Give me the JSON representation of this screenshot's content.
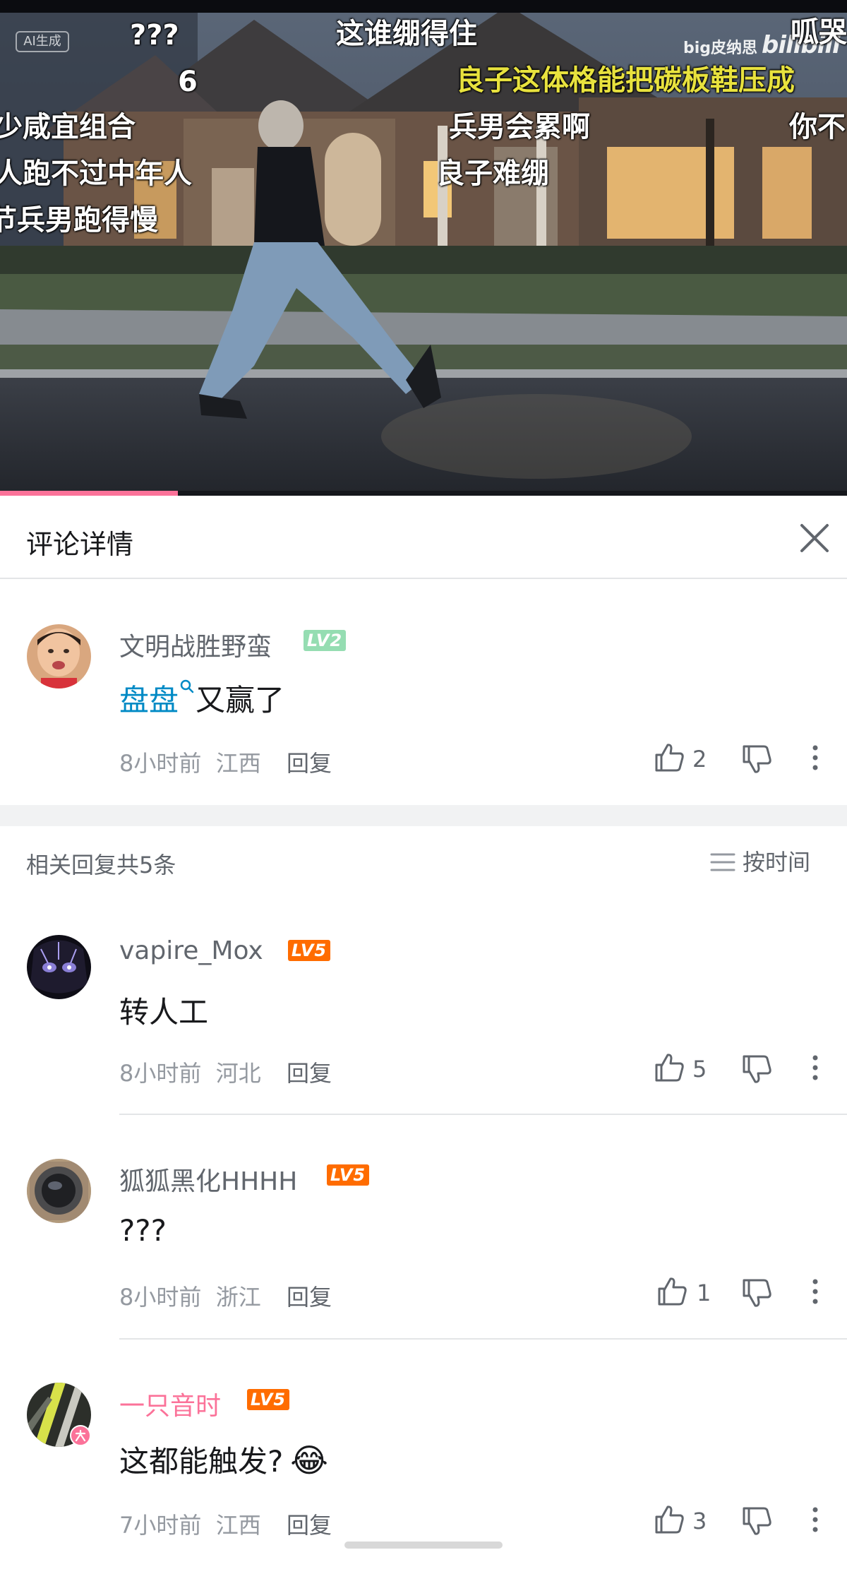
{
  "video": {
    "ai_badge": "AI生成",
    "watermark_name": "big皮纳思",
    "watermark_logo": "bilibili",
    "progress_fraction": 0.21,
    "danmaku": [
      {
        "text": "???",
        "color": "white"
      },
      {
        "text": "这谁绷得住",
        "color": "white"
      },
      {
        "text": "呱哭",
        "color": "white"
      },
      {
        "text": "6",
        "color": "white"
      },
      {
        "text": "良子这体格能把碳板鞋压成",
        "color": "yellow"
      },
      {
        "text": "少咸宜组合",
        "color": "white"
      },
      {
        "text": "兵男会累啊",
        "color": "white"
      },
      {
        "text": "你不",
        "color": "white"
      },
      {
        "text": "人跑不过中年人",
        "color": "white"
      },
      {
        "text": "良子难绷",
        "color": "white"
      },
      {
        "text": "节兵男跑得慢",
        "color": "white"
      }
    ]
  },
  "panel": {
    "title": "评论详情"
  },
  "root_comment": {
    "username": "文明战胜野蛮",
    "level": "LV2",
    "link_text": "盘盘",
    "text": "又赢了",
    "time": "8小时前",
    "location": "江西",
    "reply": "回复",
    "likes": "2"
  },
  "replies_header": {
    "count_text": "相关回复共5条",
    "sort_label": "按时间"
  },
  "replies": [
    {
      "username": "vapire_Mox",
      "level": "LV5",
      "text": "转人工",
      "time": "8小时前",
      "location": "河北",
      "reply": "回复",
      "likes": "5"
    },
    {
      "username": "狐狐黑化HHHH",
      "level": "LV5",
      "text": "???",
      "time": "8小时前",
      "location": "浙江",
      "reply": "回复",
      "likes": "1"
    },
    {
      "username": "一只音时",
      "level": "LV5",
      "text": "这都能触发?",
      "emoji": "😂",
      "time": "7小时前",
      "location": "江西",
      "reply": "回复",
      "likes": "3"
    }
  ],
  "colors": {
    "accent_pink": "#fb7299",
    "link_blue": "#008ac5",
    "lv2_green": "#95ddb2",
    "lv5_orange": "#ff6c00"
  }
}
